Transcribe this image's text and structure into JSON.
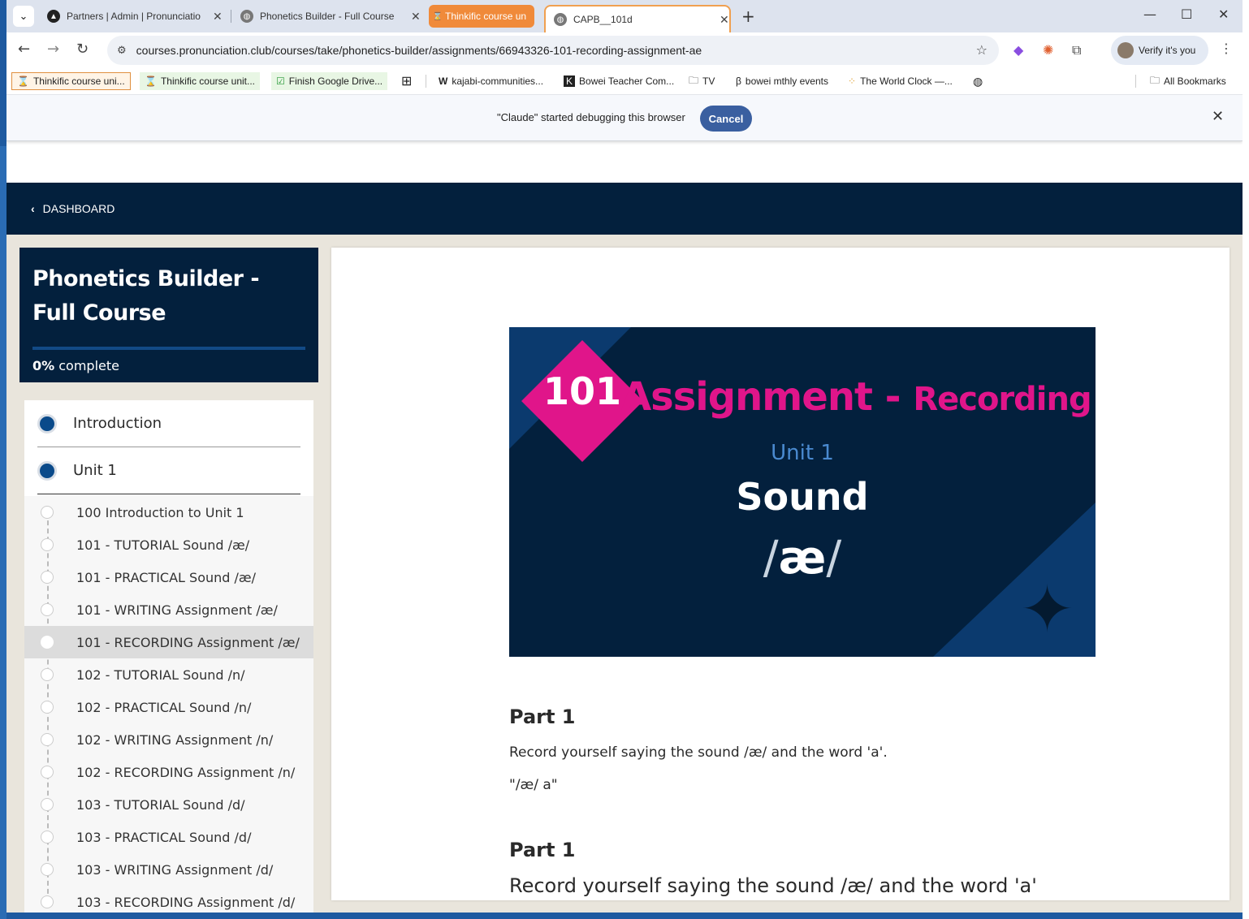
{
  "tabs": [
    {
      "label": "Partners | Admin | Pronunciatio",
      "icon": "triangle-icon"
    },
    {
      "label": "Phonetics Builder - Full Course",
      "icon": "globe-icon"
    },
    {
      "label": "Thinkific course un",
      "icon": "hourglass-icon"
    },
    {
      "label": "CAPB__101d",
      "icon": "globe-icon"
    }
  ],
  "toolbar": {
    "url": "courses.pronunciation.club/courses/take/phonetics-builder/assignments/66943326-101-recording-assignment-ae",
    "verify": "Verify it's you"
  },
  "bookmarks": [
    "Thinkific course uni...",
    "Thinkific course unit...",
    "Finish Google Drive...",
    "kajabi-communities...",
    "Bowei Teacher Com...",
    "TV",
    "bowei mthly events",
    "The World Clock —...",
    "All Bookmarks"
  ],
  "debug": {
    "message": "\"Claude\" started debugging this browser",
    "cancel": "Cancel"
  },
  "page": {
    "dashboard": "DASHBOARD",
    "course_title": "Phonetics Builder - Full Course",
    "progress_pct": "0%",
    "progress_suffix": " complete",
    "progress_fraction": 0,
    "sections": [
      "Introduction",
      "Unit 1"
    ],
    "lessons": [
      "100 Introduction to Unit 1",
      "101 - TUTORIAL Sound /æ/",
      "101 - PRACTICAL Sound /æ/",
      "101 - WRITING Assignment /æ/",
      "101 - RECORDING Assignment /æ/",
      "102 - TUTORIAL Sound /n/",
      "102 - PRACTICAL Sound /n/",
      "102 - WRITING Assignment /n/",
      "102 - RECORDING Assignment /n/",
      "103 - TUTORIAL Sound /d/",
      "103 - PRACTICAL Sound /d/",
      "103 - WRITING Assignment /d/",
      "103 - RECORDING Assignment /d/"
    ],
    "active_lesson": 4
  },
  "banner": {
    "number": "101",
    "title_main": "Assignment - ",
    "title_small": "Recording",
    "unit": "Unit 1",
    "sound": "Sound",
    "ipa_left": "/",
    "ipa_char": "æ",
    "ipa_right": "/"
  },
  "content": {
    "part1_heading": "Part 1",
    "part1_text": "Record yourself saying the sound /æ/ and the word 'a'.",
    "part1_quote": "\"/æ/ a\"",
    "part2_heading": "Part 1",
    "part2_text": "Record yourself saying the sound /æ/ and the word 'a'"
  },
  "colors": {
    "navy": "#03203d",
    "magenta": "#e0158a",
    "accent_blue": "#3a5fa0"
  }
}
